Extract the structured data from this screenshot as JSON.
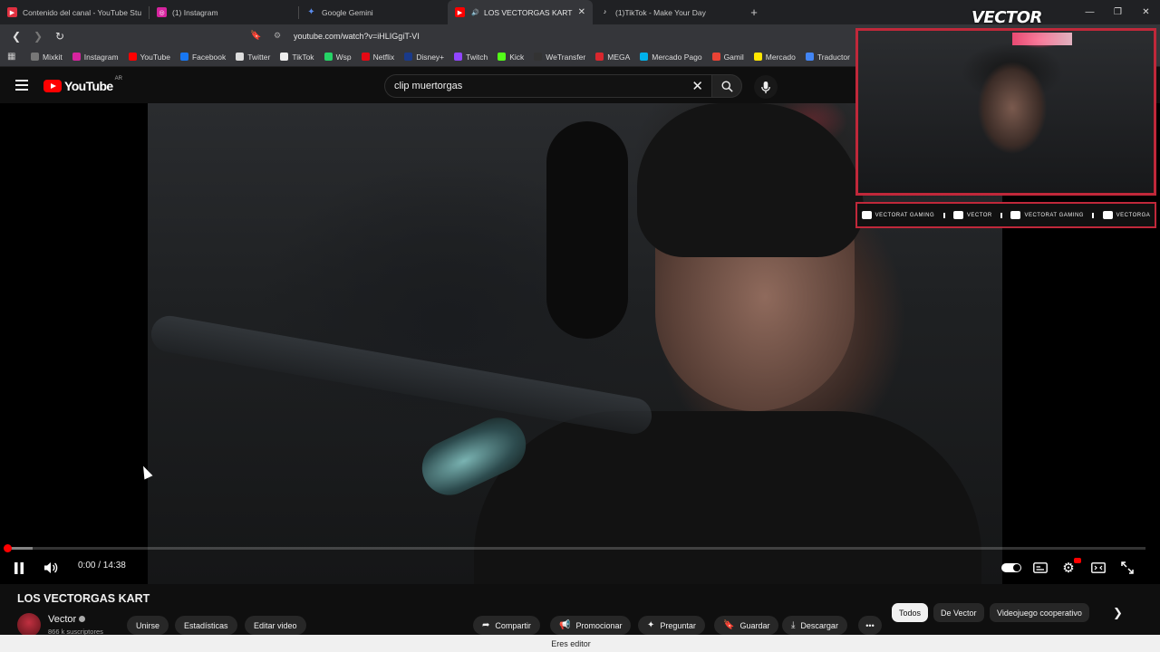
{
  "browser": {
    "tabs": [
      {
        "title": "Contenido del canal - YouTube Studio",
        "icon": "youtube-studio-icon",
        "color": "#e03040",
        "active": false
      },
      {
        "title": "(1) Instagram",
        "icon": "instagram-icon",
        "color": "#d6249f",
        "active": false
      },
      {
        "title": "Google Gemini",
        "icon": "gemini-icon",
        "color": "#5b8def",
        "active": false
      },
      {
        "title": "LOS VECTORGAS KART - YouT",
        "icon": "youtube-icon",
        "color": "#ff0000",
        "active": true
      },
      {
        "title": "(1)TikTok - Make Your Day",
        "icon": "tiktok-icon",
        "color": "#ffffff",
        "active": false
      }
    ],
    "url": "youtube.com/watch?v=iHLIGgiT-VI",
    "bookmarks": [
      {
        "label": "Mixkit",
        "color": "#777777"
      },
      {
        "label": "Instagram",
        "color": "#d6249f"
      },
      {
        "label": "YouTube",
        "color": "#ff0000"
      },
      {
        "label": "Facebook",
        "color": "#1877f2"
      },
      {
        "label": "Twitter",
        "color": "#dddddd"
      },
      {
        "label": "TikTok",
        "color": "#eeeeee"
      },
      {
        "label": "Wsp",
        "color": "#25d366"
      },
      {
        "label": "Netflix",
        "color": "#e50914"
      },
      {
        "label": "Disney+",
        "color": "#1a3a8a"
      },
      {
        "label": "Twitch",
        "color": "#9146ff"
      },
      {
        "label": "Kick",
        "color": "#53fc18"
      },
      {
        "label": "WeTransfer",
        "color": "#333333"
      },
      {
        "label": "MEGA",
        "color": "#d9272e"
      },
      {
        "label": "Mercado Pago",
        "color": "#00b1ea"
      },
      {
        "label": "Gamil",
        "color": "#ea4335"
      },
      {
        "label": "Mercado",
        "color": "#ffe600"
      },
      {
        "label": "Traductor",
        "color": "#4285f4"
      }
    ]
  },
  "youtube": {
    "logo_text": "YouTube",
    "country_code": "AR",
    "search_value": "clip muertorgas",
    "player": {
      "current_time": "0:00",
      "duration": "14:38",
      "time_display": "0:00 / 14:38",
      "played_fraction": 0.0,
      "buffered_fraction": 0.022
    },
    "video_title": "LOS VECTORGAS KART",
    "channel_name": "Vector",
    "subscribers": "866 k suscriptores",
    "channel_buttons": [
      "Unirse",
      "Estadísticas",
      "Editar video"
    ],
    "actions": [
      {
        "label": "Compartir",
        "icon": "share-icon"
      },
      {
        "label": "Promocionar",
        "icon": "megaphone-icon"
      },
      {
        "label": "Preguntar",
        "icon": "sparkle-icon"
      },
      {
        "label": "Guardar",
        "icon": "bookmark-icon"
      },
      {
        "label": "Descargar",
        "icon": "download-icon"
      }
    ],
    "chips": [
      "Todos",
      "De Vector",
      "Videojuego cooperativo"
    ],
    "editor_notice": "Eres editor"
  },
  "overlay": {
    "brand": "VECTOR",
    "socials": [
      "VECTORAT GAMING",
      "VECTOR",
      "VECTORAT GAMING",
      "VECTORGA"
    ]
  },
  "colors": {
    "accent": "#ff0000",
    "overlay_border": "#c0283a",
    "background": "#0f0f0f"
  }
}
